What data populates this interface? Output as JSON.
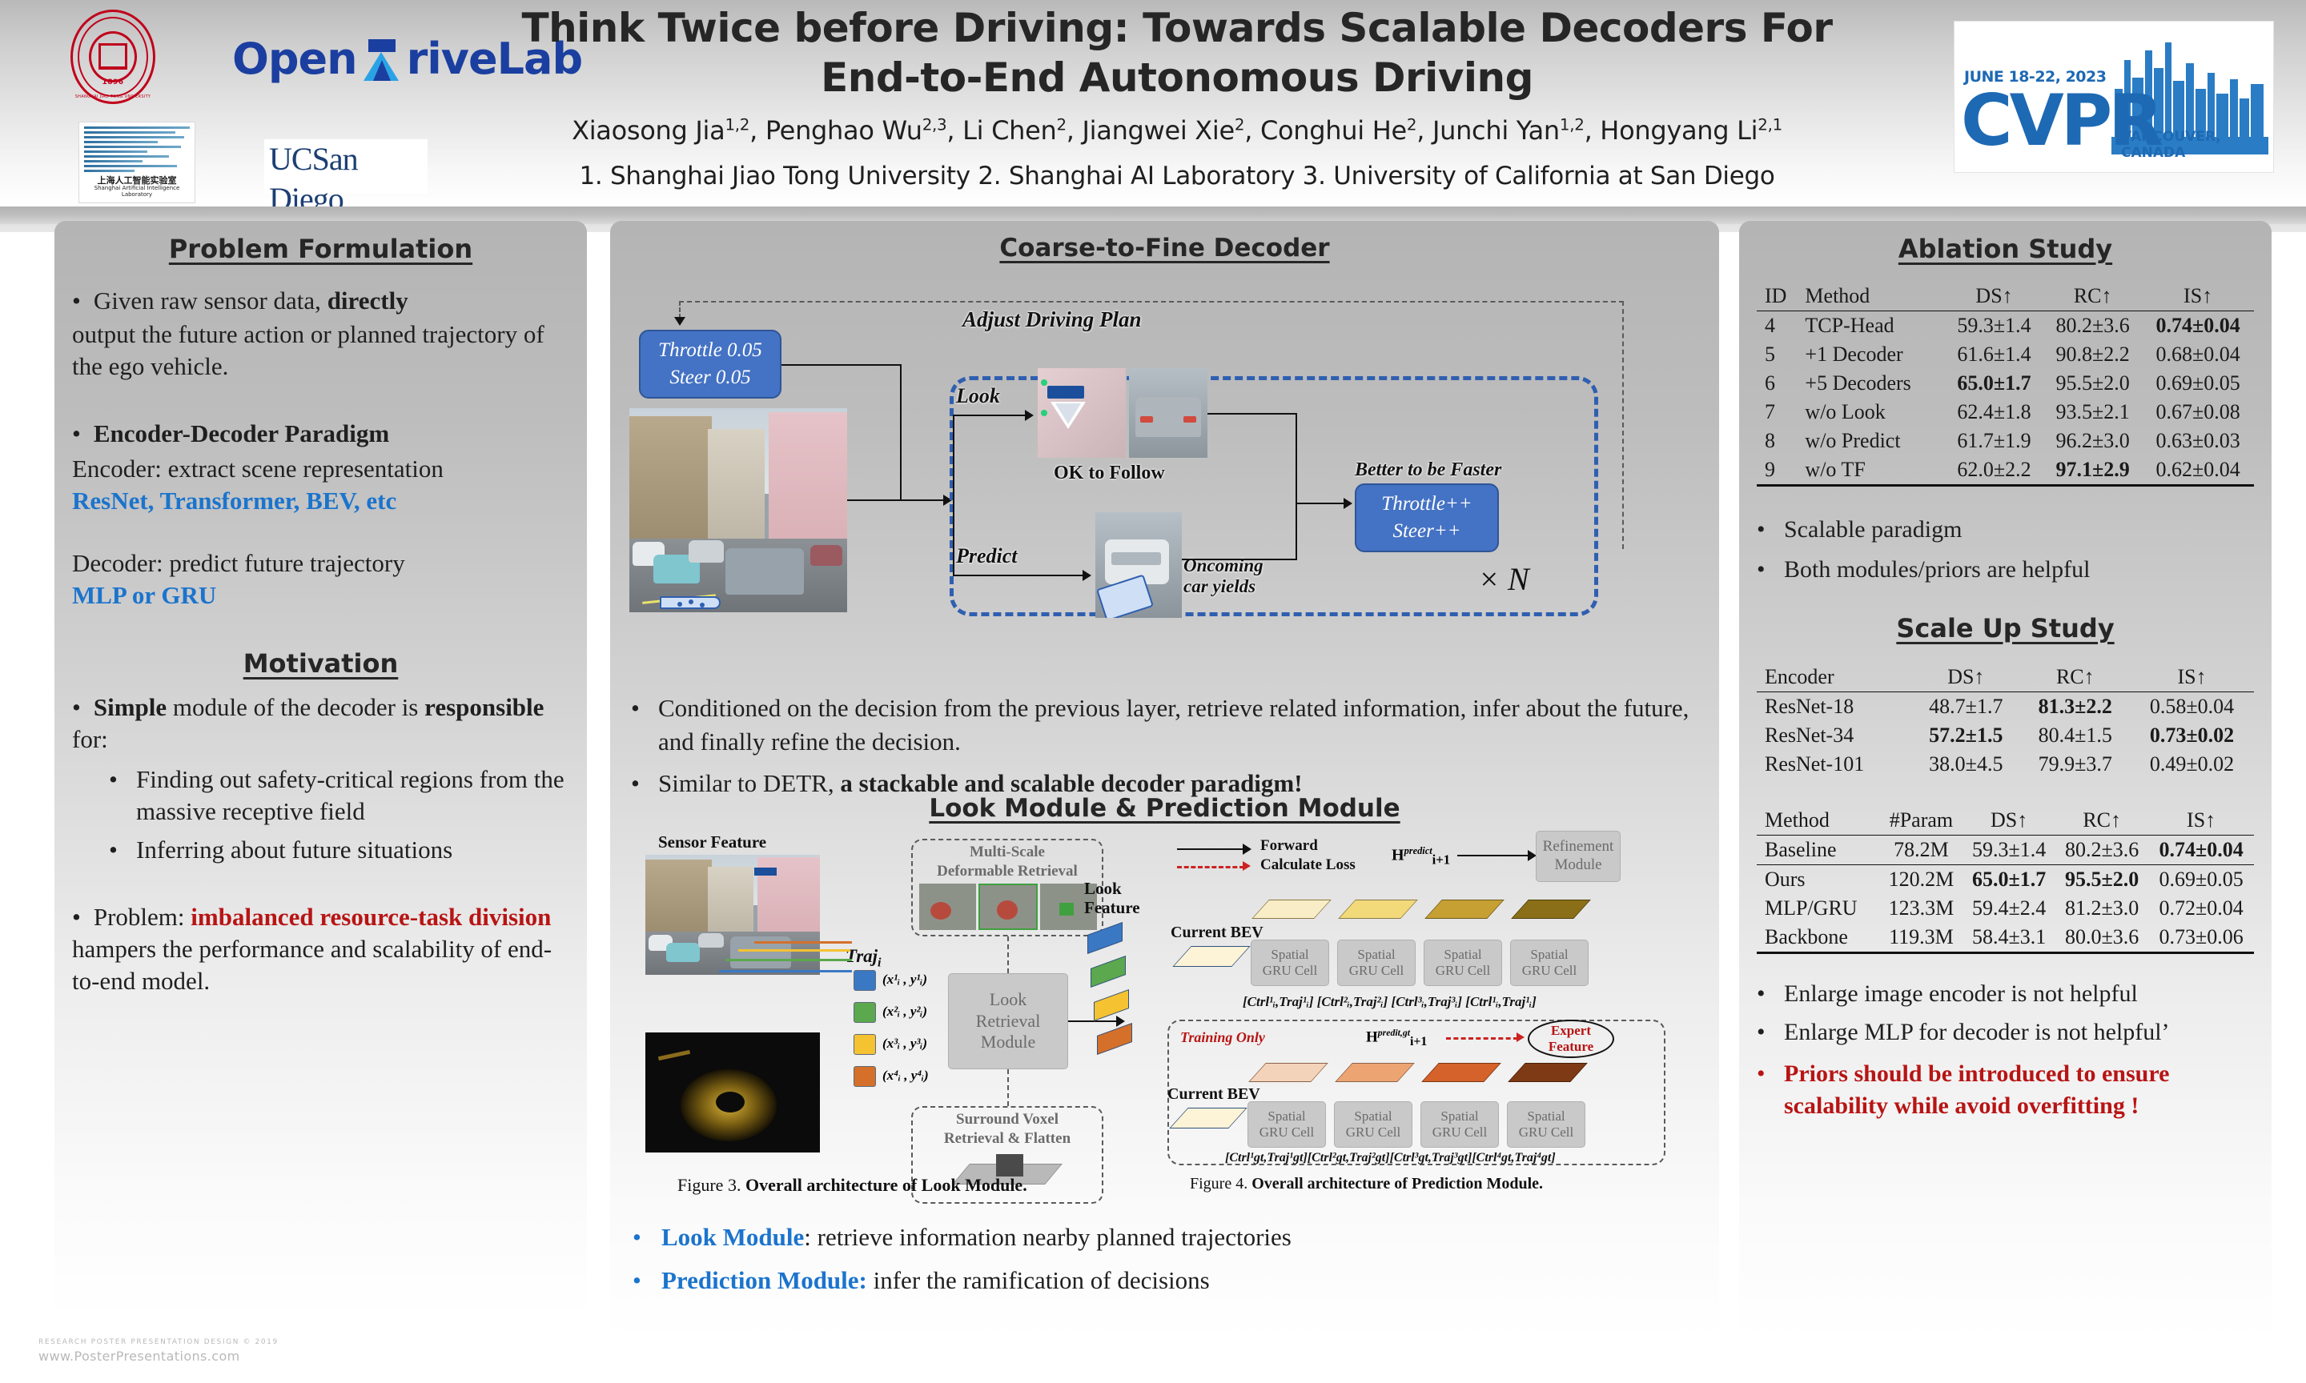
{
  "header": {
    "title_line1": "Think Twice before Driving: Towards Scalable Decoders For",
    "title_line2": "End-to-End Autonomous Driving",
    "authors": "Xiaosong Jia1,2, Penghao Wu2,3, Li Chen2, Jiangwei Xie2, Conghui He2, Junchi Yan1,2, Hongyang Li2,1",
    "affiliations": "1. Shanghai Jiao Tong University  2. Shanghai AI Laboratory 3. University of California at San Diego",
    "logos": {
      "sjtu_year": "1896",
      "sjtu_arc": "SHANGHAI JIAO TONG UNIVERSITY",
      "sail_cn": "上海人工智能实验室",
      "sail_en": "Shanghai Artificial Intelligence Laboratory",
      "opendrivelab_pre": "Open",
      "opendrivelab_post": "riveLab",
      "ucsd": "UCSan Diego"
    },
    "cvpr": {
      "date": "JUNE 18-22, 2023",
      "name": "CVPR",
      "city": "VANCOUVER, CANADA"
    }
  },
  "left": {
    "section1_title": "Problem Formulation",
    "b1_pre": "Given raw sensor data, ",
    "b1_bold": "directly",
    "b1_rest": "output the future action or planned trajectory of the ego vehicle.",
    "b2_bold": "Encoder-Decoder Paradigm",
    "encoder_line": "Encoder: extract scene representation",
    "encoder_blue": "ResNet, Transformer, BEV, etc",
    "decoder_line": "Decoder: predict future trajectory",
    "decoder_blue": "MLP or GRU",
    "section2_title": "Motivation",
    "m1_bold1": "Simple",
    "m1_mid": " module of the decoder is ",
    "m1_bold2": "responsible",
    "m1_end": " for:",
    "sub1": "Finding out safety-critical regions from the massive receptive field",
    "sub2": "Inferring about future situations",
    "problem_pre": "Problem: ",
    "problem_red": "imbalanced resource-task division",
    "problem_rest": " hampers the performance and scalability of end-to-end model."
  },
  "center": {
    "section1_title": "Coarse-to-Fine Decoder",
    "diagram1": {
      "adjust_label": "Adjust Driving Plan",
      "ctrl_box_line1": "Throttle 0.05",
      "ctrl_box_line2": "Steer 0.05",
      "look_label": "Look",
      "predict_label": "Predict",
      "ok_to_follow": "OK to Follow",
      "oncoming_line1": "Oncoming",
      "oncoming_line2": "car yields",
      "better_faster": "Better to be Faster",
      "out_box_line1": "Throttle++",
      "out_box_line2": "Steer++",
      "repeat": "× N"
    },
    "bullet1": "Conditioned on the decision from the previous layer, retrieve related information, infer about the future, and finally refine the decision.",
    "bullet2_pre": "Similar to DETR, ",
    "bullet2_bold": "a stackable and scalable decoder paradigm!",
    "section2_title": "Look Module & Prediction Module",
    "fig3": {
      "sensor_feature": "Sensor Feature",
      "multi_scale_l1": "Multi-Scale",
      "multi_scale_l2": "Deformable Retrieval",
      "traj_label": "Traj",
      "traj_sub": "i",
      "points": [
        "(x¹ᵢ , y¹ᵢ)",
        "(x²ᵢ , y²ᵢ)",
        "(x³ᵢ , y³ᵢ)",
        "(x⁴ᵢ , y⁴ᵢ)"
      ],
      "look_retrieval_l1": "Look",
      "look_retrieval_l2": "Retrieval",
      "look_retrieval_l3": "Module",
      "surround_l1": "Surround Voxel",
      "surround_l2": "Retrieval & Flatten",
      "look_feature_l1": "Look",
      "look_feature_l2": "Feature",
      "caption_pre": "Figure 3. ",
      "caption_bold": "Overall architecture of Look Module."
    },
    "fig4": {
      "legend_forward": "Forward",
      "legend_loss": "Calculate Loss",
      "h_predict": "H",
      "h_predict_sup": "predict",
      "h_predict_sub": "i+1",
      "refinement_l1": "Refinement",
      "refinement_l2": "Module",
      "current_bev": "Current BEV",
      "gru_l1": "Spatial",
      "gru_l2": "GRU Cell",
      "inputs_top": "[Ctrl¹ᵢ,Traj¹ᵢ] [Ctrl²ᵢ,Traj²ᵢ] [Ctrl³ᵢ,Traj³ᵢ] [Ctrl¹ᵢ,Traj¹ᵢ]",
      "training_only": "Training Only",
      "h_gt": "H",
      "h_gt_sup": "predit,gt",
      "h_gt_sub": "i+1",
      "expert_l1": "Expert",
      "expert_l2": "Feature",
      "inputs_bottom": "[Ctrl¹gt,Traj¹gt][Ctrl²gt,Traj²gt][Ctrl³gt,Traj³gt][Ctrl⁴gt,Traj⁴gt]",
      "caption_pre": "Figure 4. ",
      "caption_bold": "Overall architecture of Prediction Module."
    },
    "bullet3_blue": "Look Module",
    "bullet3_rest": ": retrieve information nearby planned trajectories",
    "bullet4_blue": "Prediction Module:",
    "bullet4_rest": " infer the ramification of decisions"
  },
  "right": {
    "ablation_title": "Ablation Study",
    "ablation_table": {
      "headers": [
        "ID",
        "Method",
        "DS↑",
        "RC↑",
        "IS↑"
      ],
      "rows": [
        [
          "4",
          "TCP-Head",
          "59.3±1.4",
          "80.2±3.6",
          "0.74±0.04"
        ],
        [
          "5",
          "+1 Decoder",
          "61.6±1.4",
          "90.8±2.2",
          "0.68±0.04"
        ],
        [
          "6",
          "+5 Decoders",
          "65.0±1.7",
          "95.5±2.0",
          "0.69±0.05"
        ],
        [
          "7",
          "w/o Look",
          "62.4±1.8",
          "93.5±2.1",
          "0.67±0.08"
        ],
        [
          "8",
          "w/o Predict",
          "61.7±1.9",
          "96.2±3.0",
          "0.63±0.03"
        ],
        [
          "9",
          "w/o TF",
          "62.0±2.2",
          "97.1±2.9",
          "0.62±0.04"
        ]
      ],
      "bold_cells": [
        [
          0,
          4
        ],
        [
          2,
          2
        ],
        [
          5,
          3
        ]
      ]
    },
    "bullet1": "Scalable paradigm",
    "bullet2": "Both modules/priors are helpful",
    "scaleup_title": "Scale Up Study",
    "encoder_table": {
      "headers": [
        "Encoder",
        "DS↑",
        "RC↑",
        "IS↑"
      ],
      "rows": [
        [
          "ResNet-18",
          "48.7±1.7",
          "81.3±2.2",
          "0.58±0.04"
        ],
        [
          "ResNet-34",
          "57.2±1.5",
          "80.4±1.5",
          "0.73±0.02"
        ],
        [
          "ResNet-101",
          "38.0±4.5",
          "79.9±3.7",
          "0.49±0.02"
        ]
      ],
      "bold_cells": [
        [
          0,
          2
        ],
        [
          1,
          1
        ],
        [
          1,
          3
        ]
      ]
    },
    "method_table": {
      "headers": [
        "Method",
        "#Param",
        "DS↑",
        "RC↑",
        "IS↑"
      ],
      "rows": [
        [
          "Baseline",
          "78.2M",
          "59.3±1.4",
          "80.2±3.6",
          "0.74±0.04"
        ],
        [
          "Ours",
          "120.2M",
          "65.0±1.7",
          "95.5±2.0",
          "0.69±0.05"
        ],
        [
          "MLP/GRU",
          "123.3M",
          "59.4±2.4",
          "81.2±3.0",
          "0.72±0.04"
        ],
        [
          "Backbone",
          "119.3M",
          "58.4±3.1",
          "80.0±3.6",
          "0.73±0.06"
        ]
      ],
      "bold_cells": [
        [
          0,
          4
        ],
        [
          1,
          2
        ],
        [
          1,
          3
        ]
      ]
    },
    "bullet3": "Enlarge image encoder is not helpful",
    "bullet4": "Enlarge MLP for decoder is not helpful’",
    "bullet5": "Priors should be introduced to ensure scalability while avoid overfitting !"
  },
  "footer": {
    "line1": "RESEARCH POSTER PRESENTATION  DESIGN © 2019",
    "line2": "www.PosterPresentations.com"
  },
  "colors": {
    "blue_accent": "#1b74cd",
    "red_accent": "#b81414",
    "box_blue": "#4472c4",
    "cvpr_blue": "#1d69b4"
  }
}
